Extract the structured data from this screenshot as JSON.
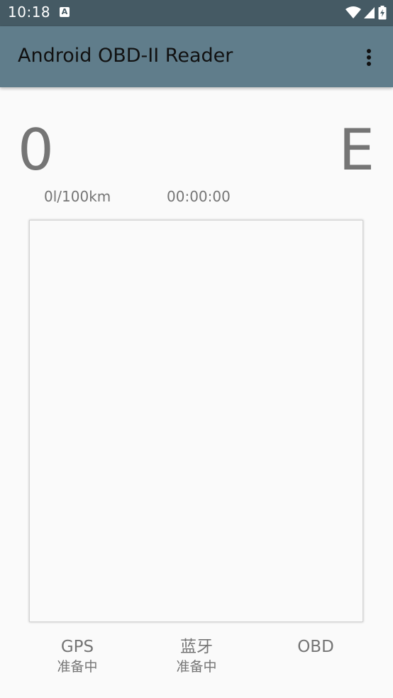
{
  "status_bar": {
    "time": "10:18",
    "notification_icon": "text-a-icon",
    "icons": [
      "wifi-icon",
      "cell-signal-icon",
      "battery-charging-icon"
    ]
  },
  "app_bar": {
    "title": "Android OBD-II Reader",
    "overflow_icon": "more-vert-icon"
  },
  "dashboard": {
    "speed": "0",
    "gear": "E",
    "fuel_consumption": "0l/100km",
    "trip_time": "00:00:00"
  },
  "indicators": {
    "gps": {
      "label": "GPS",
      "status": "准备中"
    },
    "bluetooth": {
      "label": "蓝牙",
      "status": "准备中"
    },
    "obd": {
      "label": "OBD",
      "status": ""
    }
  },
  "colors": {
    "status_bar": "#455a64",
    "app_bar": "#607d8b",
    "background": "#fafafa",
    "text_secondary": "#757575"
  }
}
